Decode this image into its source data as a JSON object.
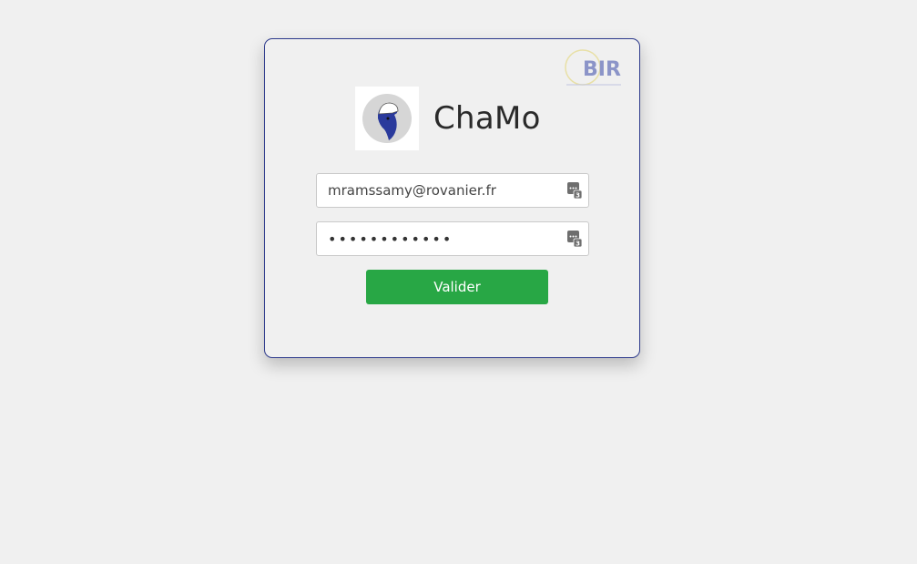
{
  "brand": {
    "name": "ChaMo",
    "corner_logo_text": "BIR"
  },
  "login": {
    "email_value": "mramssamy@rovanier.fr",
    "password_value": "••••••••••••",
    "submit_label": "Valider"
  },
  "colors": {
    "card_border": "#2d3a8c",
    "submit_bg": "#28a745",
    "page_bg": "#f0f0f0"
  },
  "icons": {
    "password_manager": "password-manager-icon"
  }
}
